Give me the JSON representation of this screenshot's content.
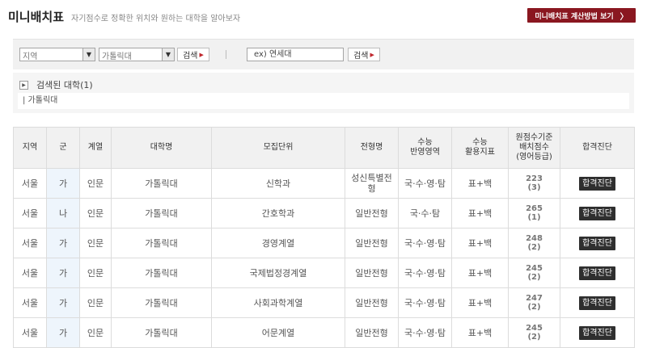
{
  "header": {
    "title": "미니배치표",
    "subtitle": "자기점수로 정확한 위치와 원하는 대학을 알아보자",
    "calc_button": "미니배치표 계산방법 보기",
    "calc_chevron": "〉"
  },
  "search": {
    "region_select": "지역",
    "university_select": "가톨릭대",
    "search_button": "검색",
    "keyword_value": "ex) 연세대",
    "search_button2": "검색"
  },
  "results": {
    "heading": "검색된 대학(1)",
    "item": "| 가톨릭대"
  },
  "table": {
    "headers": {
      "region": "지역",
      "gun": "군",
      "field": "계열",
      "university": "대학명",
      "unit": "모집단위",
      "admission": "전형명",
      "suneung_area_1": "수능",
      "suneung_area_2": "반영영역",
      "suneung_index_1": "수능",
      "suneung_index_2": "활용지표",
      "score_1": "원점수기준",
      "score_2": "배치점수",
      "score_3": "(영어등급)",
      "diagnosis": "합격진단"
    },
    "rows": [
      {
        "region": "서울",
        "gun": "가",
        "field": "인문",
        "university": "가톨릭대",
        "unit": "신학과",
        "admission_1": "성신특별전",
        "admission_2": "형",
        "area": "국·수·영·탐",
        "index": "표+백",
        "score": "223",
        "grade": "(3)",
        "diagnosis": "합격진단"
      },
      {
        "region": "서울",
        "gun": "나",
        "field": "인문",
        "university": "가톨릭대",
        "unit": "간호학과",
        "admission_1": "일반전형",
        "admission_2": "",
        "area": "국·수·탐",
        "index": "표+백",
        "score": "265",
        "grade": "(1)",
        "diagnosis": "합격진단"
      },
      {
        "region": "서울",
        "gun": "가",
        "field": "인문",
        "university": "가톨릭대",
        "unit": "경영계열",
        "admission_1": "일반전형",
        "admission_2": "",
        "area": "국·수·영·탐",
        "index": "표+백",
        "score": "248",
        "grade": "(2)",
        "diagnosis": "합격진단"
      },
      {
        "region": "서울",
        "gun": "가",
        "field": "인문",
        "university": "가톨릭대",
        "unit": "국제법정경계열",
        "admission_1": "일반전형",
        "admission_2": "",
        "area": "국·수·영·탐",
        "index": "표+백",
        "score": "245",
        "grade": "(2)",
        "diagnosis": "합격진단"
      },
      {
        "region": "서울",
        "gun": "가",
        "field": "인문",
        "university": "가톨릭대",
        "unit": "사회과학계열",
        "admission_1": "일반전형",
        "admission_2": "",
        "area": "국·수·영·탐",
        "index": "표+백",
        "score": "247",
        "grade": "(2)",
        "diagnosis": "합격진단"
      },
      {
        "region": "서울",
        "gun": "가",
        "field": "인문",
        "university": "가톨릭대",
        "unit": "어문계열",
        "admission_1": "일반전형",
        "admission_2": "",
        "area": "국·수·영·탐",
        "index": "표+백",
        "score": "245",
        "grade": "(2)",
        "diagnosis": "합격진단"
      }
    ]
  }
}
